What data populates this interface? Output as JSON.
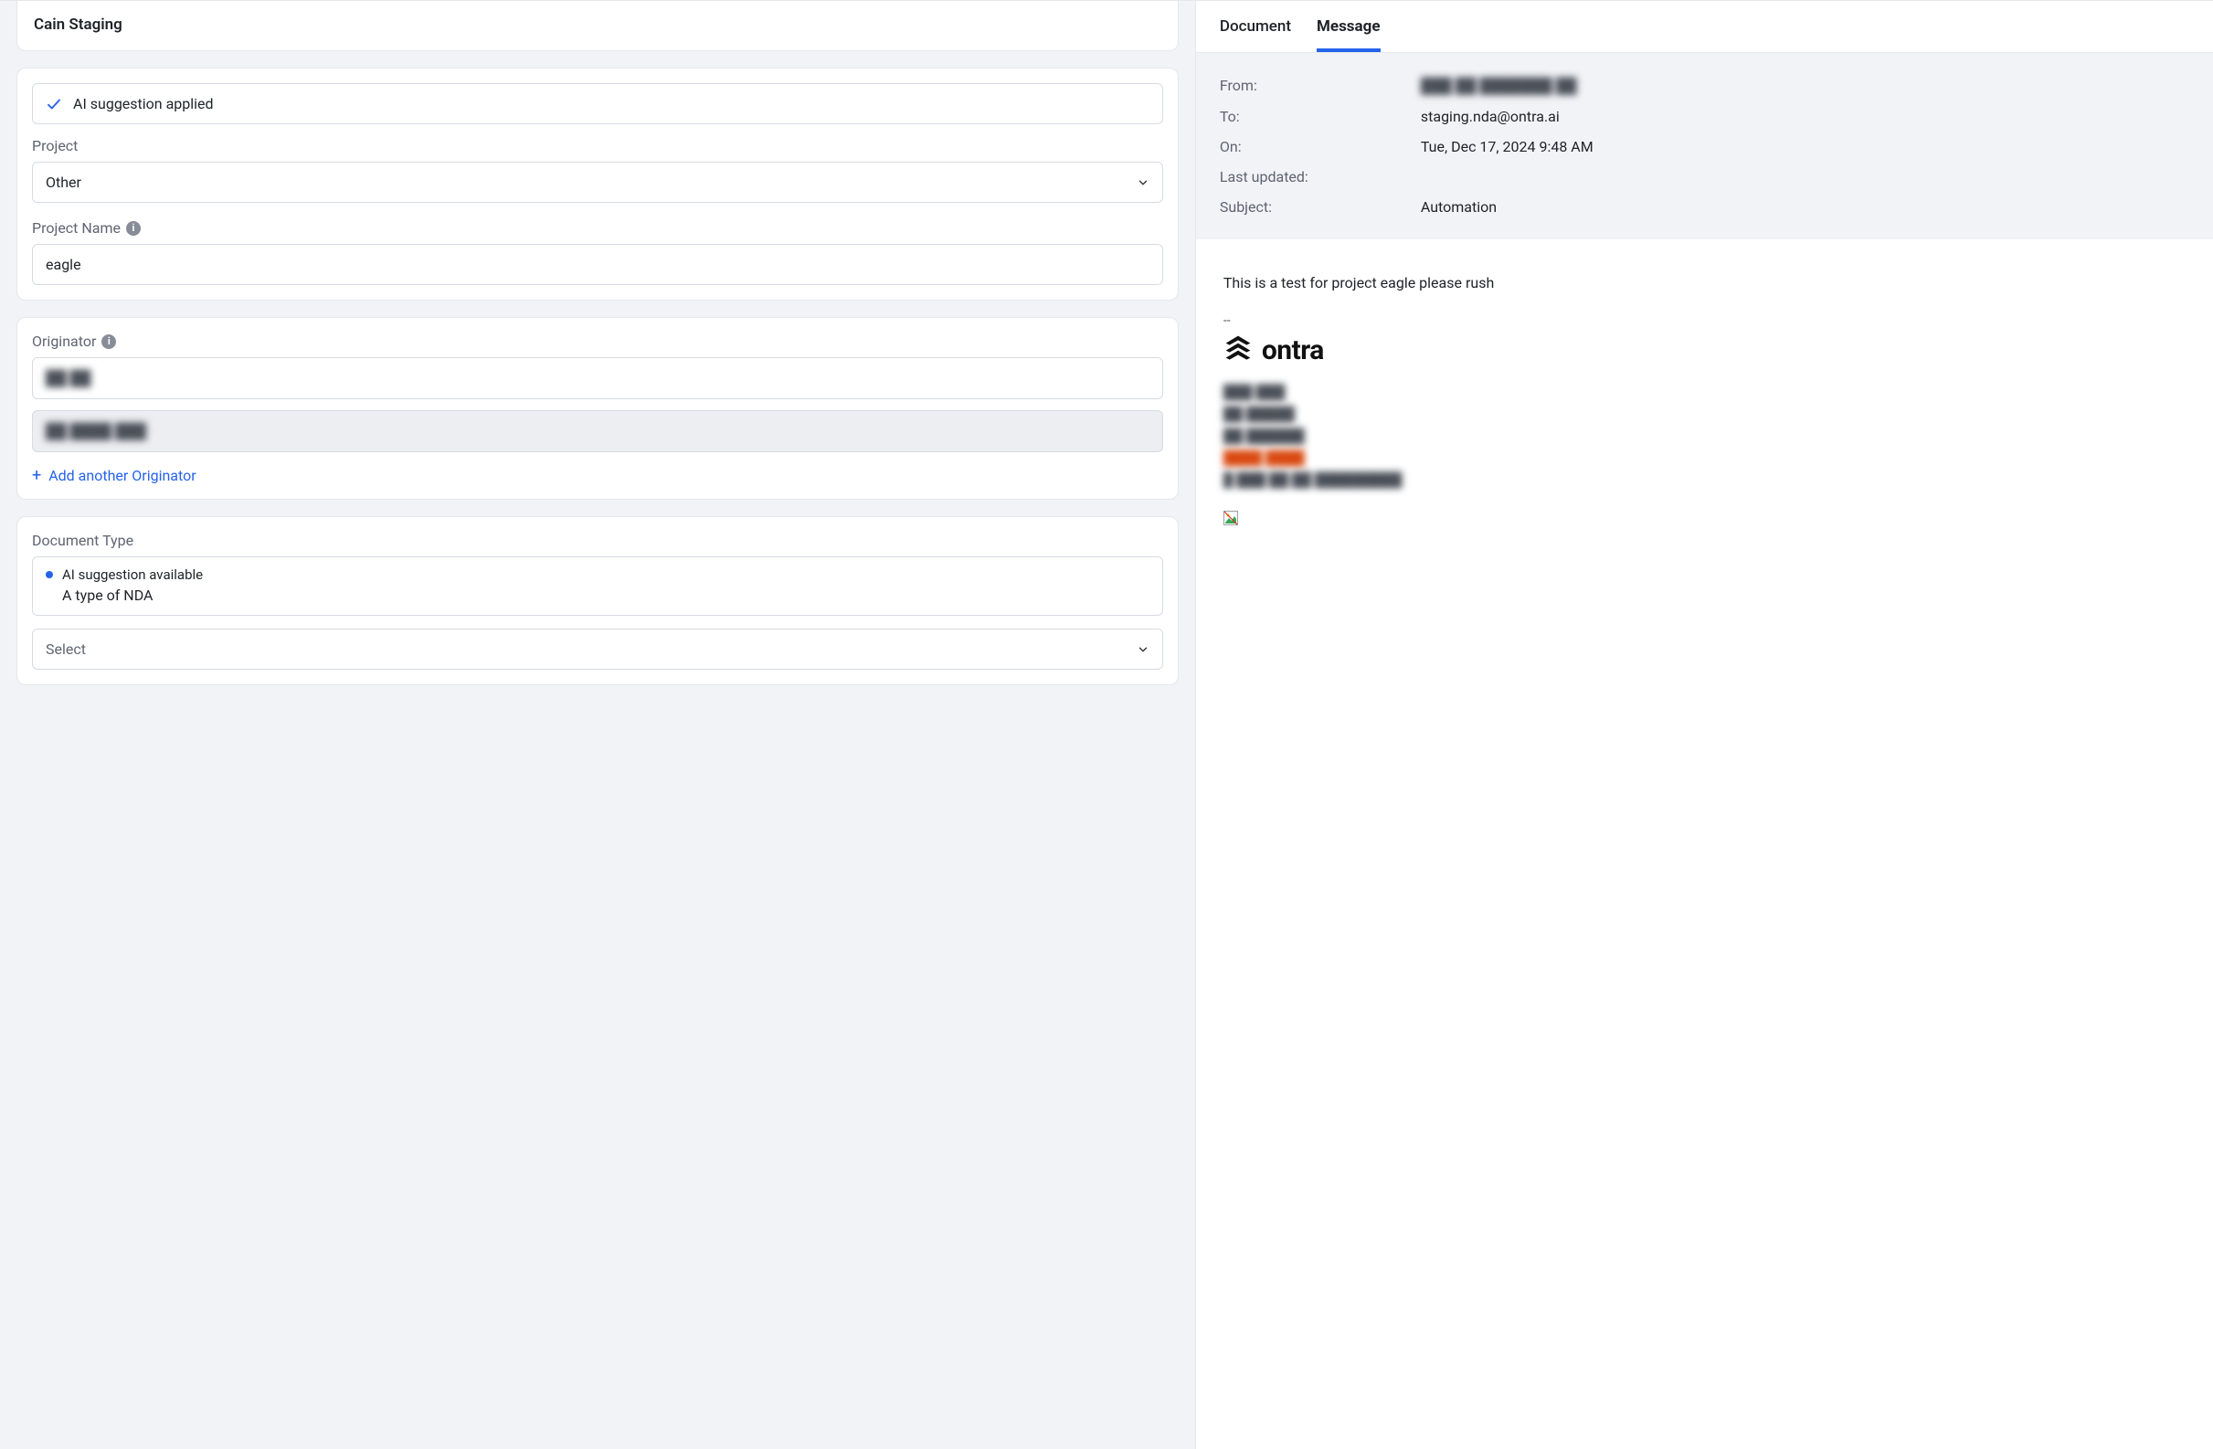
{
  "left": {
    "stage_title": "Cain Staging",
    "ai_applied_banner": "AI suggestion applied",
    "project_label": "Project",
    "project_value": "Other",
    "project_name_label": "Project Name",
    "project_name_value": "eagle",
    "originator_label": "Originator",
    "originator_value_1": "██ ██",
    "originator_value_2": "██ ████ ███",
    "add_originator_label": "Add another Originator",
    "doc_type_label": "Document Type",
    "ai_available_label": "AI suggestion available",
    "ai_available_value": "A type of NDA",
    "doc_type_select_placeholder": "Select"
  },
  "right": {
    "tabs": {
      "document": "Document",
      "message": "Message"
    },
    "meta": {
      "from_label": "From:",
      "from_value": "███ ██ ███████ ██",
      "to_label": "To:",
      "to_value": "staging.nda@ontra.ai",
      "on_label": "On:",
      "on_value": "Tue, Dec 17, 2024 9:48 AM",
      "last_updated_label": "Last updated:",
      "last_updated_value": "",
      "subject_label": "Subject:",
      "subject_value": "Automation"
    },
    "body_text": "This is a test for project eagle please rush",
    "signature_sep": "--",
    "logo_word": "ontra",
    "signature_lines": [
      "███ ███",
      "██ █████",
      "██ ██████",
      "████ ████",
      "█ ███ ██ ██ █████████"
    ]
  }
}
